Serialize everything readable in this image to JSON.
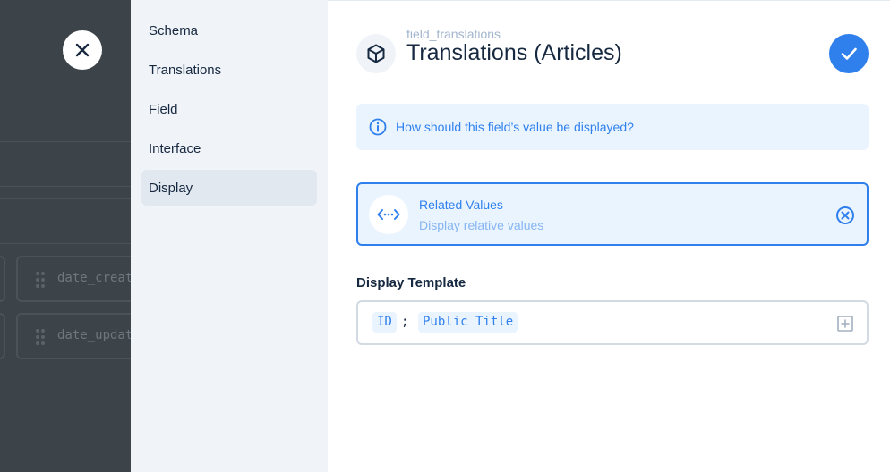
{
  "backdrop": {
    "fields": [
      "date_created",
      "date_updated"
    ]
  },
  "sidebar": {
    "items": [
      {
        "label": "Schema"
      },
      {
        "label": "Translations"
      },
      {
        "label": "Field"
      },
      {
        "label": "Interface"
      },
      {
        "label": "Display"
      }
    ],
    "active": "Display"
  },
  "header": {
    "subtitle": "field_translations",
    "title": "Translations (Articles)",
    "icon": "box-icon",
    "save_icon": "check-icon"
  },
  "notice": {
    "icon": "info-icon",
    "text": "How should this field’s value be displayed?"
  },
  "display": {
    "icon": "code-arrows-icon",
    "name": "Related Values",
    "description": "Display relative values",
    "deselect_icon": "close-circle-icon"
  },
  "template": {
    "label": "Display Template",
    "tokens": [
      "ID",
      "Public Title"
    ],
    "separator": ";",
    "add_icon": "add-box-icon"
  },
  "colors": {
    "accent": "#2f80ed",
    "accent_bg": "#eaf4fe",
    "sidebar_bg": "#f0f4f9",
    "backdrop": "#3d4449",
    "text": "#172940"
  }
}
